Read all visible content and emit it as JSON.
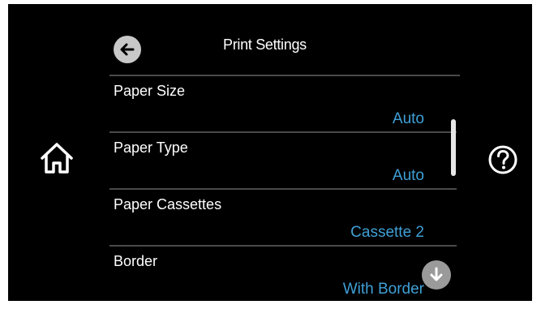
{
  "header": {
    "title": "Print Settings"
  },
  "settings": [
    {
      "label": "Paper Size",
      "value": "Auto"
    },
    {
      "label": "Paper Type",
      "value": "Auto"
    },
    {
      "label": "Paper Cassettes",
      "value": "Cassette 2"
    },
    {
      "label": "Border",
      "value": "With Border"
    }
  ],
  "icons": {
    "back": "back-arrow-icon",
    "home": "home-icon",
    "help": "help-icon",
    "scroll_down": "arrow-down-icon"
  },
  "colors": {
    "background": "#000000",
    "label": "#ffffff",
    "value": "#3fa0d6",
    "separator": "#4a4a4a"
  }
}
